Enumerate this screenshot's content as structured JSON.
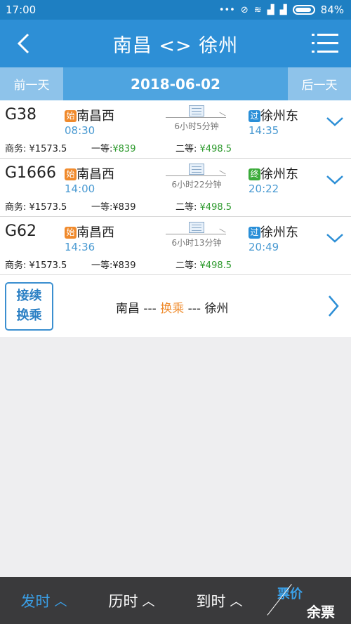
{
  "status_bar": {
    "time": "17:00",
    "icons": [
      "dots-icon",
      "alarm-off-icon",
      "wifi-icon",
      "signal-icon",
      "signal-icon",
      "battery-icon"
    ],
    "battery": "84%"
  },
  "header": {
    "title": "南昌 <> 徐州"
  },
  "date_bar": {
    "prev_label": "前一天",
    "date": "2018-06-02",
    "next_label": "后一天"
  },
  "trains": [
    {
      "number": "G38",
      "from_badge": "始",
      "from": "南昌西",
      "dep_time": "08:30",
      "duration": "6小时5分钟",
      "to_badge": "过",
      "to": "徐州东",
      "arr_time": "14:35",
      "business_label": "商务:",
      "business_price": "¥1573.5",
      "first_label": "一等:",
      "first_price": "¥839",
      "second_label": "二等:",
      "second_price": "¥498.5"
    },
    {
      "number": "G1666",
      "from_badge": "始",
      "from": "南昌西",
      "dep_time": "14:00",
      "duration": "6小时22分钟",
      "to_badge": "终",
      "to": "徐州东",
      "arr_time": "20:22",
      "business_label": "商务:",
      "business_price": "¥1573.5",
      "first_label": "一等:",
      "first_price": "¥839",
      "second_label": "二等:",
      "second_price": "¥498.5"
    },
    {
      "number": "G62",
      "from_badge": "始",
      "from": "南昌西",
      "dep_time": "14:36",
      "duration": "6小时13分钟",
      "to_badge": "过",
      "to": "徐州东",
      "arr_time": "20:49",
      "business_label": "商务:",
      "business_price": "¥1573.5",
      "first_label": "一等:",
      "first_price": "¥839",
      "second_label": "二等:",
      "second_price": "¥498.5"
    }
  ],
  "transfer": {
    "button_line1": "接续",
    "button_line2": "换乘",
    "from": "南昌",
    "sep1": " --- ",
    "middle": "换乘",
    "sep2": " --- ",
    "to": "徐州"
  },
  "sort_bar": {
    "depart": "发时",
    "duration": "历时",
    "arrive": "到时",
    "price": "票价",
    "remaining": "余票",
    "active_color": "#3aa0e8"
  }
}
